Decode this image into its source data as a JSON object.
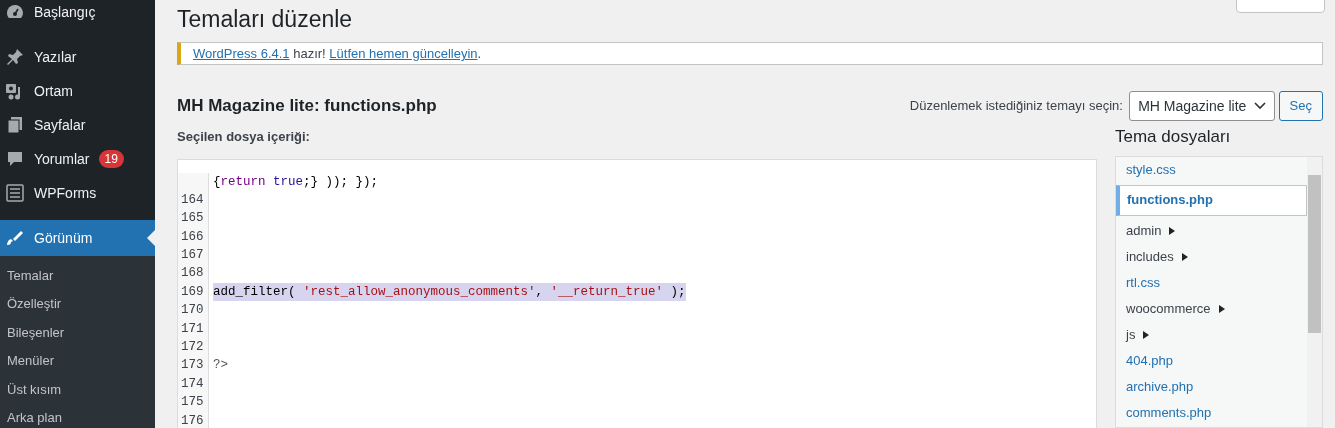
{
  "sidebar": {
    "items": [
      {
        "label": "Başlangıç",
        "current": false
      },
      {
        "label": "Yazılar",
        "current": false
      },
      {
        "label": "Ortam",
        "current": false
      },
      {
        "label": "Sayfalar",
        "current": false
      },
      {
        "label": "Yorumlar",
        "current": false,
        "badge": "19"
      },
      {
        "label": "WPForms",
        "current": false
      },
      {
        "label": "Görünüm",
        "current": true,
        "submenu": [
          "Temalar",
          "Özelleştir",
          "Bileşenler",
          "Menüler",
          "Üst kısım",
          "Arka plan"
        ]
      }
    ]
  },
  "page_title": "Temaları düzenle",
  "notice": {
    "link_1": "WordPress 6.4.1",
    "text": " hazır! ",
    "link_2": "Lütfen hemen güncelleyin",
    "end": "."
  },
  "file_heading": "MH Magazine lite: functions.php",
  "theme_select": {
    "label": "Düzenlemek istediğiniz temayı seçin:",
    "value": "MH Magazine lite",
    "button": "Seç"
  },
  "content_label": "Seçilen dosya içeriği:",
  "editor": {
    "lines": [
      {
        "tokens": [
          {
            "kind": "plain",
            "text": "{"
          },
          {
            "kind": "keyword",
            "text": "return "
          },
          {
            "kind": "atom",
            "text": "true"
          },
          {
            "kind": "plain",
            "text": ";} )); });"
          }
        ],
        "selected": false
      },
      {
        "number": "164",
        "selected": false
      },
      {
        "number": "165",
        "selected": false
      },
      {
        "number": "166",
        "selected": false
      },
      {
        "number": "167",
        "selected": false
      },
      {
        "number": "168",
        "selected": false
      },
      {
        "number": "169",
        "tokens": [
          {
            "kind": "plain",
            "text": "add_filter( "
          },
          {
            "kind": "string",
            "text": "'rest_allow_anonymous_comments'"
          },
          {
            "kind": "plain",
            "text": ", "
          },
          {
            "kind": "string",
            "text": "'__return_true'"
          },
          {
            "kind": "plain",
            "text": " );"
          }
        ],
        "selected": true
      },
      {
        "number": "170",
        "selected": false
      },
      {
        "number": "171",
        "selected": false
      },
      {
        "number": "172",
        "selected": false
      },
      {
        "number": "173",
        "tokens": [
          {
            "kind": "meta",
            "text": "?>"
          }
        ],
        "selected": false
      },
      {
        "number": "174",
        "selected": false
      },
      {
        "number": "175",
        "selected": false
      },
      {
        "number": "176",
        "selected": false
      }
    ]
  },
  "files": {
    "title": "Tema dosyaları",
    "items": [
      {
        "name": "style.css",
        "kind": "file",
        "selected": false
      },
      {
        "name": "functions.php",
        "kind": "file",
        "selected": true
      },
      {
        "name": "admin",
        "kind": "folder",
        "selected": false
      },
      {
        "name": "includes",
        "kind": "folder",
        "selected": false
      },
      {
        "name": "rtl.css",
        "kind": "file",
        "selected": false
      },
      {
        "name": "woocommerce",
        "kind": "folder",
        "selected": false
      },
      {
        "name": "js",
        "kind": "folder",
        "selected": false
      },
      {
        "name": "404.php",
        "kind": "file",
        "selected": false
      },
      {
        "name": "archive.php",
        "kind": "file",
        "selected": false
      },
      {
        "name": "comments.php",
        "kind": "file",
        "selected": false
      }
    ]
  }
}
